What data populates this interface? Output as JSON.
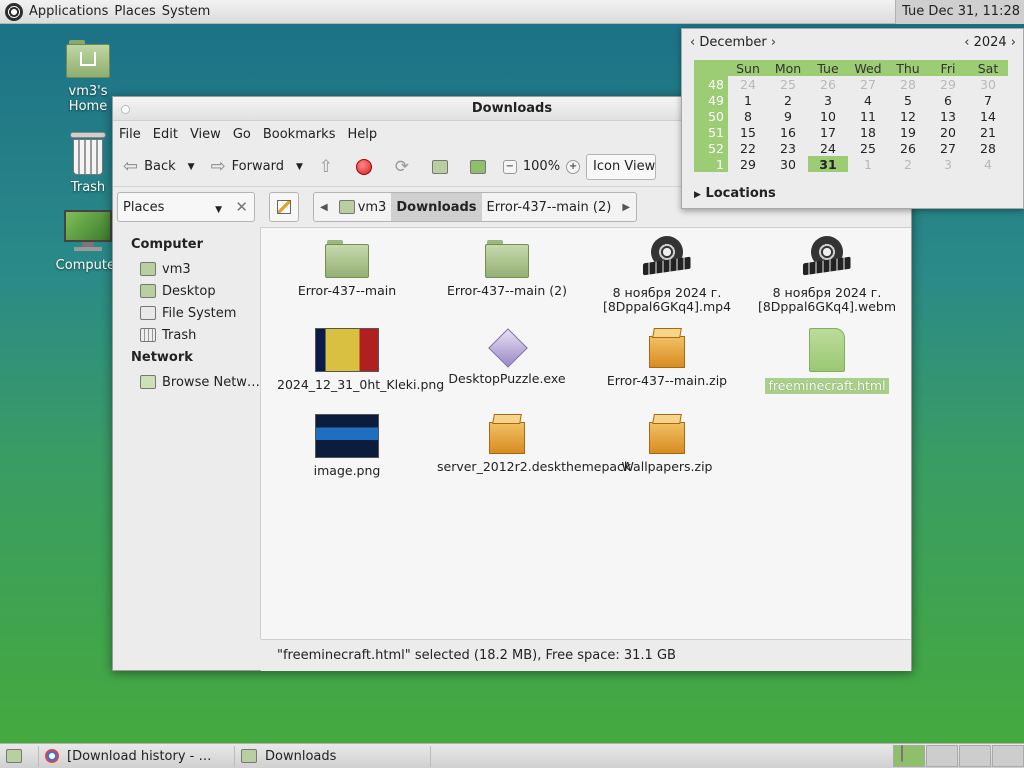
{
  "top_panel": {
    "menus": [
      "Applications",
      "Places",
      "System"
    ],
    "clock": "Tue Dec 31, 11:28"
  },
  "desktop": {
    "icons": [
      {
        "label": "vm3's Home",
        "icon": "home-folder-icon"
      },
      {
        "label": "Trash",
        "icon": "trash-icon"
      },
      {
        "label": "Computer",
        "icon": "computer-icon"
      }
    ]
  },
  "window": {
    "title": "Downloads",
    "menu": [
      "File",
      "Edit",
      "View",
      "Go",
      "Bookmarks",
      "Help"
    ],
    "toolbar": {
      "back": "Back",
      "forward": "Forward",
      "zoom": "100%",
      "view": "Icon View"
    },
    "location": {
      "places": "Places",
      "crumbs": [
        "vm3",
        "Downloads",
        "Error-437--main (2)"
      ]
    },
    "sidebar": {
      "computer_heading": "Computer",
      "computer_items": [
        "vm3",
        "Desktop",
        "File System",
        "Trash"
      ],
      "network_heading": "Network",
      "network_items": [
        "Browse Netw…"
      ]
    },
    "files": [
      {
        "name": "Error-437--main",
        "type": "folder"
      },
      {
        "name": "Error-437--main (2)",
        "type": "folder"
      },
      {
        "name": "8 ноября 2024 г. [8Dppal6GKq4].mp4",
        "type": "video"
      },
      {
        "name": "8 ноября 2024 г. [8Dppal6GKq4].webm",
        "type": "video"
      },
      {
        "name": "2024_12_31_0ht_Kleki.png",
        "type": "image"
      },
      {
        "name": "DesktopPuzzle.exe",
        "type": "executable"
      },
      {
        "name": "Error-437--main.zip",
        "type": "archive"
      },
      {
        "name": "freeminecraft.html",
        "type": "html",
        "selected": true
      },
      {
        "name": "image.png",
        "type": "image"
      },
      {
        "name": "server_2012r2.deskthemepack",
        "type": "archive"
      },
      {
        "name": "Wallpapers.zip",
        "type": "archive"
      }
    ],
    "status": "\"freeminecraft.html\" selected (18.2 MB), Free space: 31.1 GB"
  },
  "calendar": {
    "month": "December",
    "year": "2024",
    "weekdays": [
      "Sun",
      "Mon",
      "Tue",
      "Wed",
      "Thu",
      "Fri",
      "Sat"
    ],
    "weeks": [
      {
        "wk": "48",
        "days": [
          "24",
          "25",
          "26",
          "27",
          "28",
          "29",
          "30"
        ]
      },
      {
        "wk": "49",
        "days": [
          "1",
          "2",
          "3",
          "4",
          "5",
          "6",
          "7"
        ]
      },
      {
        "wk": "50",
        "days": [
          "8",
          "9",
          "10",
          "11",
          "12",
          "13",
          "14"
        ]
      },
      {
        "wk": "51",
        "days": [
          "15",
          "16",
          "17",
          "18",
          "19",
          "20",
          "21"
        ]
      },
      {
        "wk": "52",
        "days": [
          "22",
          "23",
          "24",
          "25",
          "26",
          "27",
          "28"
        ]
      },
      {
        "wk": "1",
        "days": [
          "29",
          "30",
          "31",
          "1",
          "2",
          "3",
          "4"
        ]
      }
    ],
    "today": "31",
    "locations_label": "Locations"
  },
  "bottom_panel": {
    "tasks": [
      "[Download history - …",
      "Downloads"
    ]
  }
}
